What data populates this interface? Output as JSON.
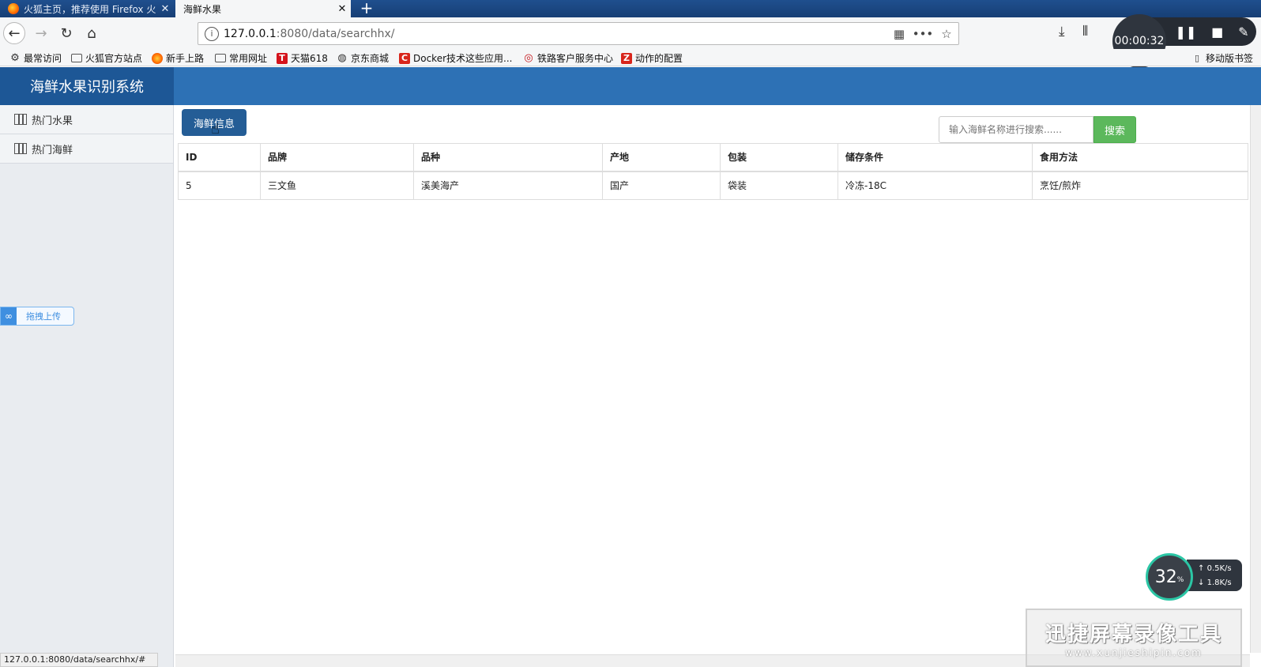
{
  "browser": {
    "tabs": [
      {
        "label": "火狐主页，推荐使用 Firefox 火",
        "active": false
      },
      {
        "label": "海鲜水果",
        "active": true
      }
    ],
    "url_host": "127.0.0.1",
    "url_rest": ":8080/data/searchhx/",
    "bookmarks": [
      {
        "label": "最常访问",
        "icon": "gear-icon"
      },
      {
        "label": "火狐官方站点",
        "icon": "folder-icon"
      },
      {
        "label": "新手上路",
        "icon": "firefox-icon"
      },
      {
        "label": "常用网址",
        "icon": "folder-icon"
      },
      {
        "label": "天猫618",
        "icon": "tmall-icon"
      },
      {
        "label": "京东商城",
        "icon": "globe-icon"
      },
      {
        "label": "Docker技术这些应用...",
        "icon": "c-icon"
      },
      {
        "label": "铁路客户服务中心",
        "icon": "rail-icon"
      },
      {
        "label": "动作的配置",
        "icon": "z-icon"
      }
    ],
    "mobile_bookmarks": "移动版书签",
    "status_url": "127.0.0.1:8080/data/searchhx/#"
  },
  "recorder": {
    "time": "00:00:32"
  },
  "app": {
    "title": "海鲜水果识别系统",
    "sidebar": [
      {
        "label": "热门水果"
      },
      {
        "label": "热门海鲜"
      }
    ],
    "upload_label": "拖拽上传",
    "tab_button": "海鲜信息",
    "search": {
      "placeholder": "输入海鲜名称进行搜索......",
      "button": "搜索"
    },
    "table": {
      "headers": [
        "ID",
        "品牌",
        "品种",
        "产地",
        "包装",
        "储存条件",
        "食用方法"
      ],
      "rows": [
        [
          "5",
          "三文鱼",
          "溪美海产",
          "国产",
          "袋装",
          "冷冻-18C",
          "烹饪/煎炸"
        ]
      ]
    }
  },
  "netmon": {
    "percent": "32",
    "percent_unit": "%",
    "up": "0.5",
    "down": "1.8",
    "unit": "K/s"
  },
  "watermark": {
    "line1": "迅捷屏幕录像工具",
    "line2": "www.xunjieshipin.com"
  }
}
